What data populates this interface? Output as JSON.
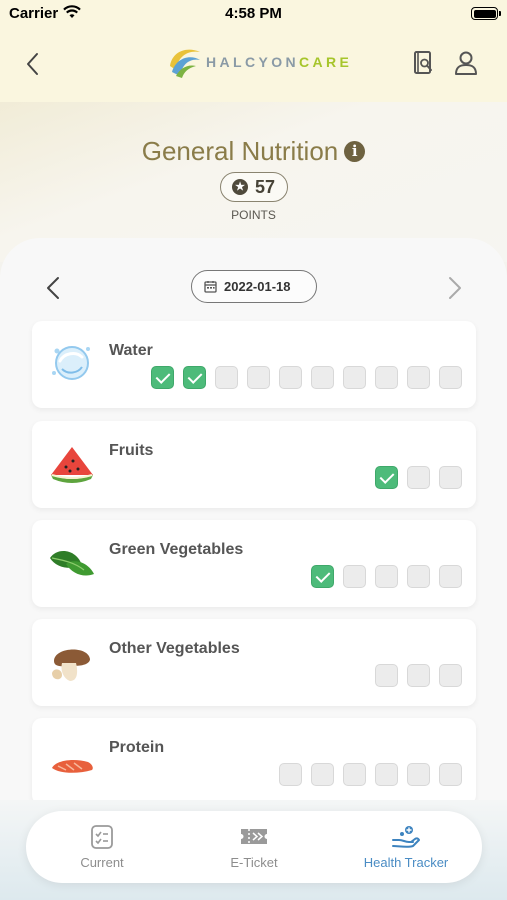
{
  "status_bar": {
    "carrier": "Carrier",
    "time": "4:58 PM"
  },
  "header": {
    "logo_text_a": "HALCYON",
    "logo_text_b": "CARE",
    "icons": [
      "back-chevron-icon",
      "book-search-icon",
      "user-icon"
    ]
  },
  "title": {
    "text": "General Nutrition",
    "info_icon": "i",
    "points_value": "57",
    "points_label": "POINTS"
  },
  "date_nav": {
    "date": "2022-01-18"
  },
  "items": [
    {
      "label": "Water",
      "icon": "water-drop-icon",
      "checks": [
        true,
        true,
        false,
        false,
        false,
        false,
        false,
        false,
        false,
        false
      ]
    },
    {
      "label": "Fruits",
      "icon": "watermelon-icon",
      "checks": [
        true,
        false,
        false
      ]
    },
    {
      "label": "Green Vegetables",
      "icon": "green-leaf-icon",
      "checks": [
        true,
        false,
        false,
        false,
        false
      ]
    },
    {
      "label": "Other Vegetables",
      "icon": "mushroom-icon",
      "checks": [
        false,
        false,
        false
      ]
    },
    {
      "label": "Protein",
      "icon": "salmon-icon",
      "checks": [
        false,
        false,
        false,
        false,
        false,
        false
      ]
    }
  ],
  "tabs": [
    {
      "label": "Current",
      "icon": "checklist-icon",
      "active": false
    },
    {
      "label": "E-Ticket",
      "icon": "ticket-icon",
      "active": false
    },
    {
      "label": "Health Tracker",
      "icon": "health-hand-icon",
      "active": true
    }
  ],
  "colors": {
    "header_bg": "#faf6df",
    "title": "#8a7c49",
    "check_on": "#4dbb7a",
    "tab_active": "#4a8cc4"
  }
}
